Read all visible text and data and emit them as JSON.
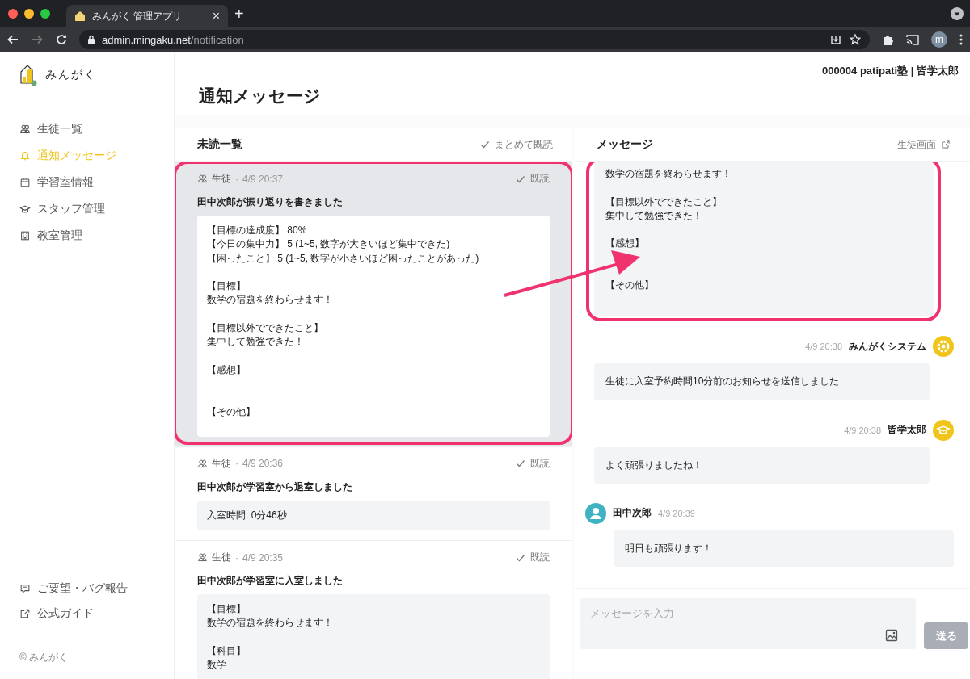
{
  "browser": {
    "tab_title": "みんがく 管理アプリ",
    "tab_close": "×",
    "new_tab": "+",
    "url_host": "admin.mingaku.net",
    "url_path": "/notification",
    "profile_initial": "m"
  },
  "sidebar": {
    "logo_text": "みんがく",
    "items": [
      {
        "label": "生徒一覧",
        "selected": false
      },
      {
        "label": "通知メッセージ",
        "selected": true
      },
      {
        "label": "学習室情報",
        "selected": false
      },
      {
        "label": "スタッフ管理",
        "selected": false
      },
      {
        "label": "教室管理",
        "selected": false
      }
    ],
    "footer_links": [
      "ご要望・バグ報告",
      "公式ガイド"
    ],
    "copyright": "© みんがく"
  },
  "header": {
    "account": "000004 patipati塾 | 皆学太郎",
    "title": "通知メッセージ"
  },
  "unread": {
    "title": "未読一覧",
    "mark_all": "まとめて既読",
    "items": [
      {
        "sender": "生徒",
        "separator": "·",
        "time": "4/9 20:37",
        "read_label": "既読",
        "headline": "田中次郎が振り返りを書きました",
        "body": [
          [
            "【目標の達成度】 80%",
            "【今日の集中力】 5 (1~5, 数字が大きいほど集中できた)",
            "【困ったこと】 5 (1~5, 数字が小さいほど困ったことがあった)"
          ],
          [
            "【目標】",
            "数学の宿題を終わらせます！"
          ],
          [
            "【目標以外でできたこと】",
            "集中して勉強できた！"
          ],
          [
            "【感想】"
          ],
          [
            "【その他】"
          ]
        ],
        "selected": true,
        "highlighted": true
      },
      {
        "sender": "生徒",
        "separator": "·",
        "time": "4/9 20:36",
        "read_label": "既読",
        "headline": "田中次郎が学習室から退室しました",
        "body": [
          [
            "入室時間: 0分46秒"
          ]
        ],
        "selected": false,
        "highlighted": false
      },
      {
        "sender": "生徒",
        "separator": "·",
        "time": "4/9 20:35",
        "read_label": "既読",
        "headline": "田中次郎が学習室に入室しました",
        "body": [
          [
            "【目標】",
            "数学の宿題を終わらせます！"
          ],
          [
            "【科目】",
            "数学"
          ]
        ],
        "selected": false,
        "highlighted": false
      }
    ]
  },
  "messages": {
    "title": "メッセージ",
    "student_view": "生徒画面",
    "items": [
      {
        "kind": "continued",
        "text": [
          [
            "数学の宿題を終わらせます！"
          ],
          [
            "【目標以外でできたこと】",
            "集中して勉強できた！"
          ],
          [
            "【感想】"
          ],
          [
            "【その他】"
          ]
        ],
        "highlighted": true
      },
      {
        "kind": "system",
        "name": "みんがくシステム",
        "time": "4/9 20:38",
        "text": [
          [
            "生徒に入室予約時間10分前のお知らせを送信しました"
          ]
        ],
        "highlighted": false
      },
      {
        "kind": "staff",
        "name": "皆学太郎",
        "time": "4/9 20:38",
        "text": [
          [
            "よく頑張りましたね！"
          ]
        ],
        "highlighted": false
      },
      {
        "kind": "student",
        "name": "田中次郎",
        "time": "4/9 20:39",
        "text": [
          [
            "明日も頑張ります！"
          ]
        ],
        "highlighted": false
      }
    ],
    "input_placeholder": "メッセージを入力",
    "send_label": "送る"
  }
}
